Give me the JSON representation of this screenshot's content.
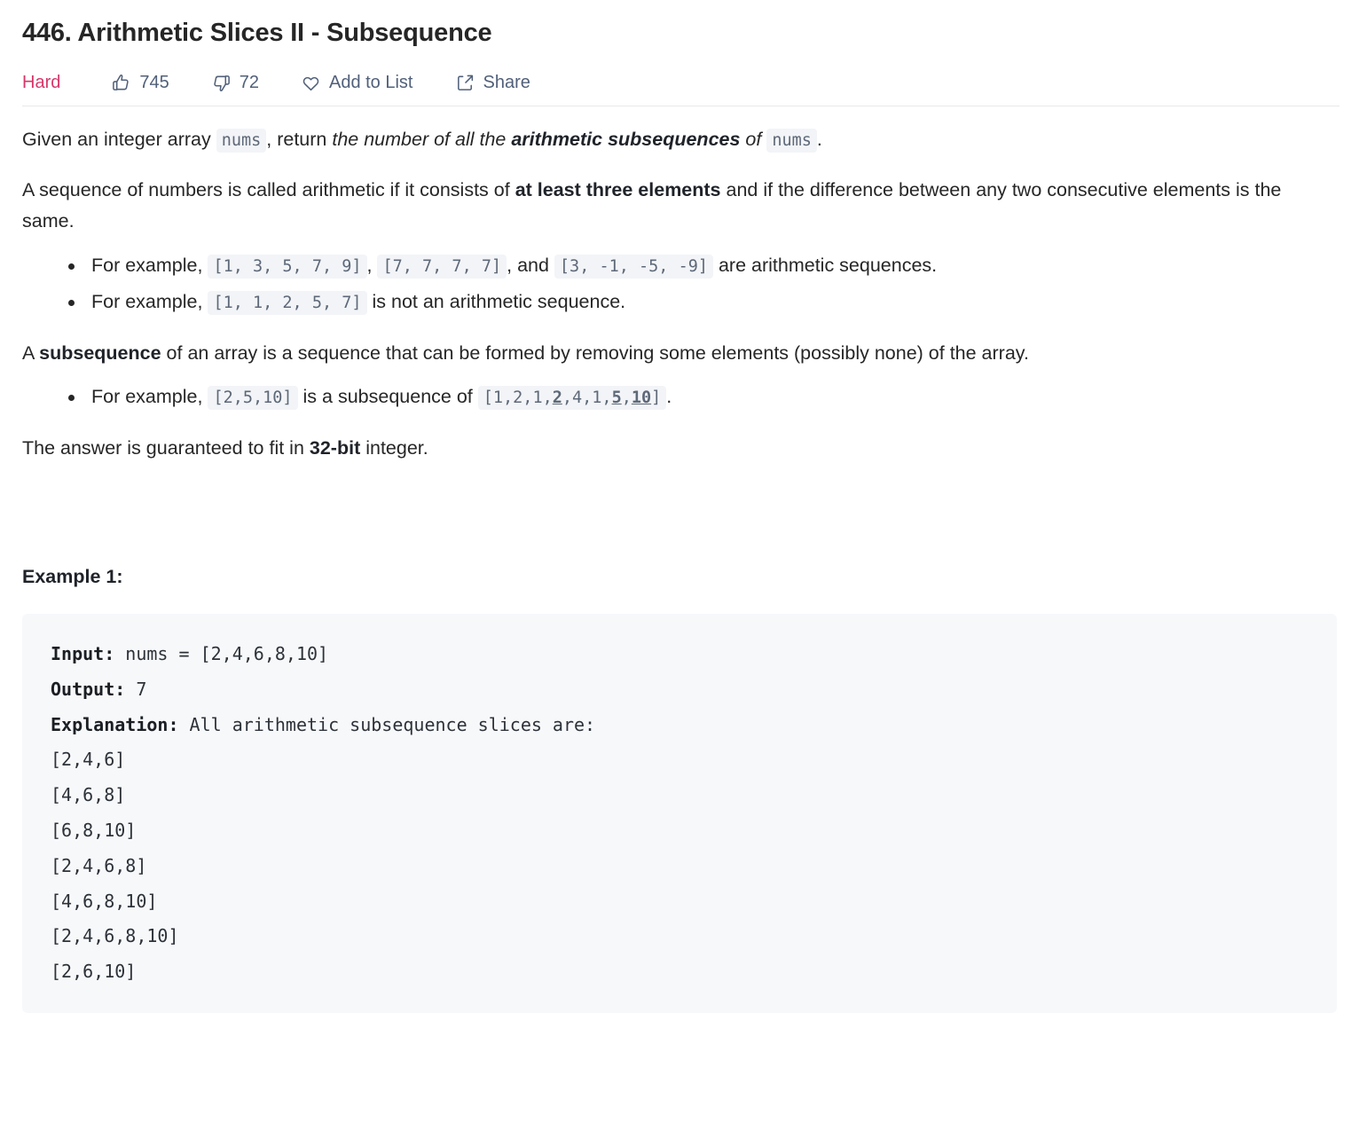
{
  "header": {
    "title": "446. Arithmetic Slices II - Subsequence",
    "difficulty": "Hard",
    "difficulty_color": "#d6376a",
    "likes": "745",
    "dislikes": "72",
    "add_to_list_label": "Add to List",
    "share_label": "Share",
    "icons": {
      "like": "thumbs-up-icon",
      "dislike": "thumbs-down-icon",
      "favorite": "heart-icon",
      "share": "share-icon"
    }
  },
  "description": {
    "para1": {
      "t1": "Given an integer array ",
      "code1": "nums",
      "t2": ", return ",
      "em1": "the number of all the ",
      "em_strong": "arithmetic subsequences",
      "em2": " of ",
      "code2": "nums",
      "t3": "."
    },
    "para2": {
      "t1": "A sequence of numbers is called arithmetic if it consists of ",
      "strong1": "at least three elements",
      "t2": " and if the difference between any two consecutive elements is the same."
    },
    "bullets_arithmetic": [
      {
        "t1": "For example, ",
        "code1": "[1, 3, 5, 7, 9]",
        "t2": ", ",
        "code2": "[7, 7, 7, 7]",
        "t3": ", and ",
        "code3": "[3, -1, -5, -9]",
        "t4": " are arithmetic sequences."
      },
      {
        "t1": "For example, ",
        "code1": "[1, 1, 2, 5, 7]",
        "t2": " is not an arithmetic sequence."
      }
    ],
    "para3": {
      "t1": "A ",
      "strong1": "subsequence",
      "t2": " of an array is a sequence that can be formed by removing some elements (possibly none) of the array."
    },
    "bullet_subsequence": {
      "t1": "For example, ",
      "code1": "[2,5,10]",
      "t2": " is a subsequence of ",
      "code2_part1": "[1,2,1,",
      "code2_bold1": "2",
      "code2_part2": ",4,1,",
      "code2_bold2": "5",
      "code2_part3": ",",
      "code2_bold3": "10",
      "code2_part4": "]",
      "t3": "."
    },
    "para4": {
      "t1": "The answer is guaranteed to fit in ",
      "strong1": "32-bit",
      "t2": " integer."
    }
  },
  "example": {
    "heading": "Example 1:",
    "input_label": "Input:",
    "input_value": " nums = [2,4,6,8,10]",
    "output_label": "Output:",
    "output_value": " 7",
    "explanation_label": "Explanation:",
    "explanation_value": " All arithmetic subsequence slices are:",
    "slices": [
      "[2,4,6]",
      "[4,6,8]",
      "[6,8,10]",
      "[2,4,6,8]",
      "[4,6,8,10]",
      "[2,4,6,8,10]",
      "[2,6,10]"
    ]
  }
}
